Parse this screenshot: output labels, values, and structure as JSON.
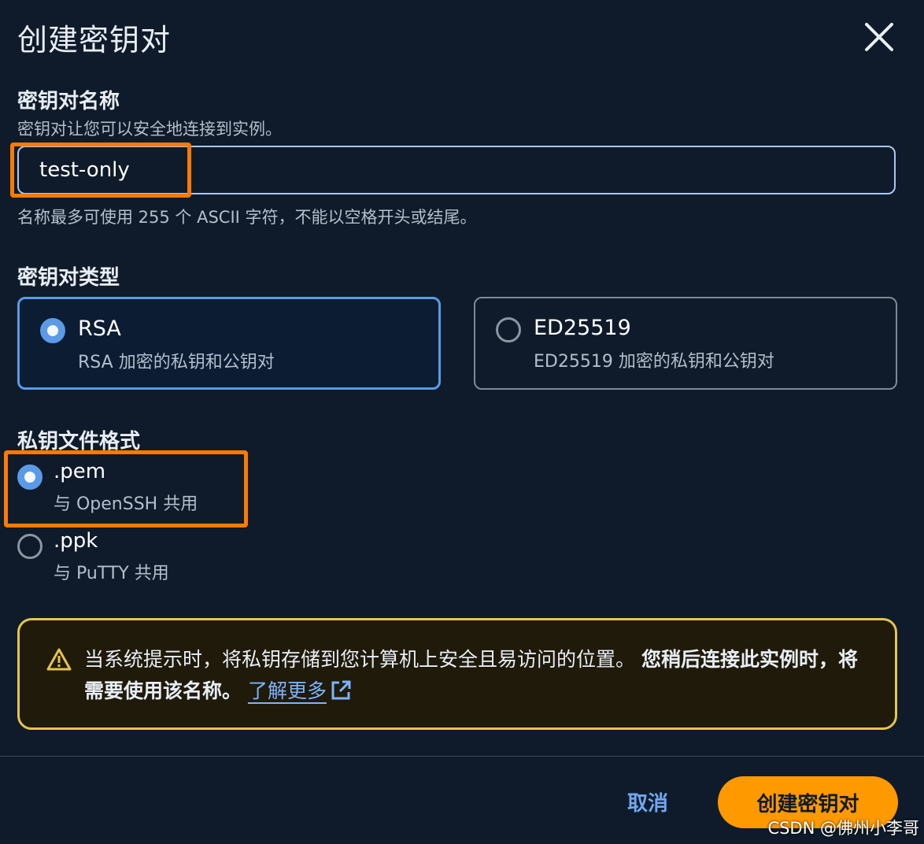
{
  "dialog": {
    "title": "创建密钥对"
  },
  "key_pair_name": {
    "label": "密钥对名称",
    "description": "密钥对让您可以安全地连接到实例。",
    "value": "test-only",
    "hint": "名称最多可使用 255 个 ASCII 字符，不能以空格开头或结尾。"
  },
  "key_pair_type": {
    "label": "密钥对类型",
    "options": [
      {
        "title": "RSA",
        "subtitle": "RSA 加密的私钥和公钥对",
        "selected": true
      },
      {
        "title": "ED25519",
        "subtitle": "ED25519 加密的私钥和公钥对",
        "selected": false
      }
    ]
  },
  "private_key_format": {
    "label": "私钥文件格式",
    "options": [
      {
        "title": ".pem",
        "subtitle": "与 OpenSSH 共用",
        "selected": true
      },
      {
        "title": ".ppk",
        "subtitle": "与 PuTTY 共用",
        "selected": false
      }
    ]
  },
  "alert": {
    "text_normal": "当系统提示时，将私钥存储到您计算机上安全且易访问的位置。",
    "text_bold": "您稍后连接此实例时，将需要使用该名称。",
    "link_label": "了解更多"
  },
  "footer": {
    "cancel_label": "取消",
    "create_label": "创建密钥对"
  },
  "watermark": "CSDN @佛州小李哥",
  "colors": {
    "background": "#0f1b2a",
    "accent_blue": "#5a9ae6",
    "primary_button": "#ff9900",
    "warning_border": "#e5c44c",
    "highlight": "#ff7a00"
  }
}
